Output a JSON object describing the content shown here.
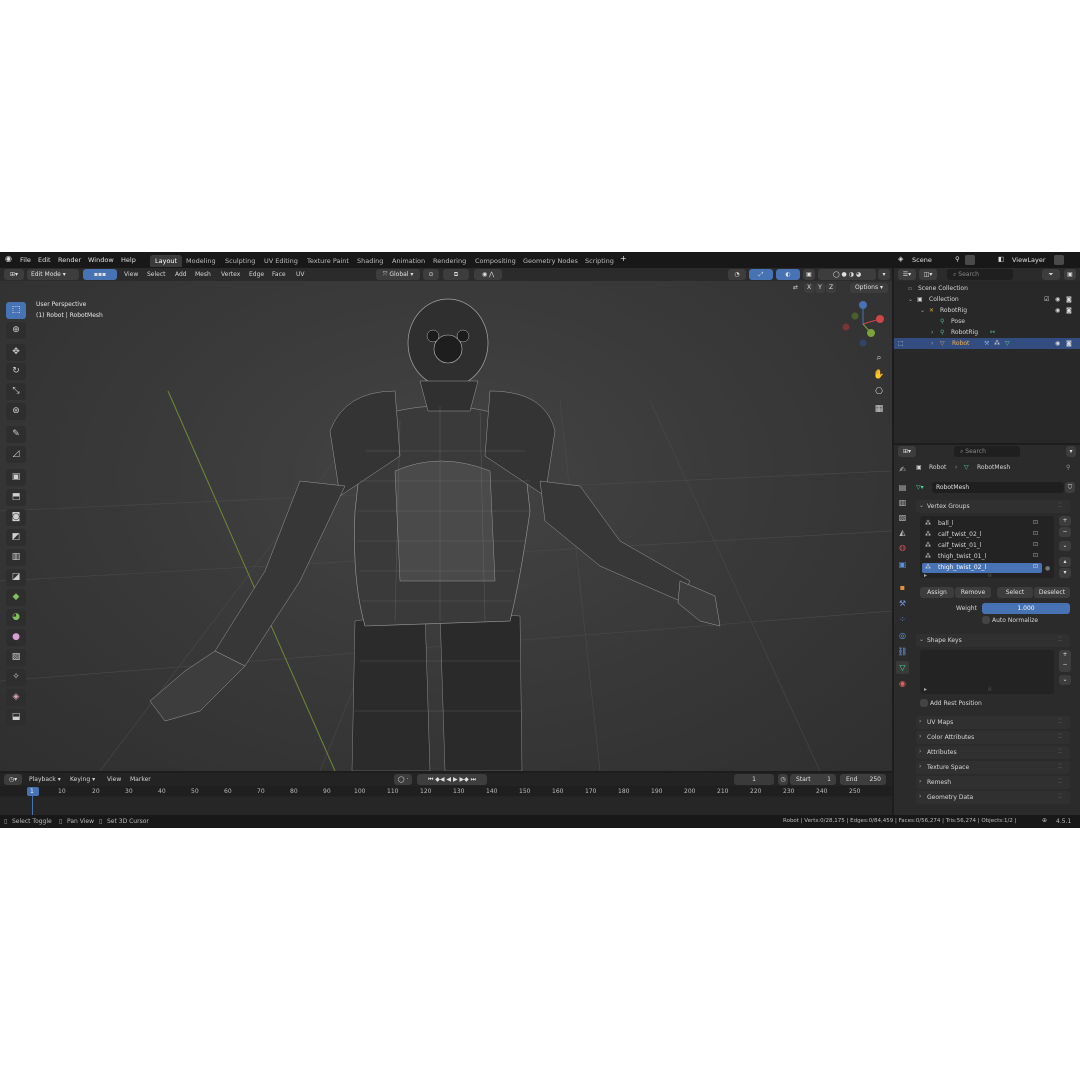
{
  "menu": [
    "File",
    "Edit",
    "Render",
    "Window",
    "Help"
  ],
  "workspaces": [
    "Layout",
    "Modeling",
    "Sculpting",
    "UV Editing",
    "Texture Paint",
    "Shading",
    "Animation",
    "Rendering",
    "Compositing",
    "Geometry Nodes",
    "Scripting"
  ],
  "active_workspace": "Layout",
  "scene": "Scene",
  "view_layer": "ViewLayer",
  "viewport_header": {
    "mode": "Edit Mode",
    "menus": [
      "View",
      "Select",
      "Add",
      "Mesh",
      "Vertex",
      "Edge",
      "Face",
      "UV"
    ],
    "orientation": "Global",
    "options": "Options",
    "axes": [
      "X",
      "Y",
      "Z"
    ]
  },
  "viewport": {
    "perspective": "User Perspective",
    "object_info": "(1) Robot | RobotMesh"
  },
  "outliner": {
    "search_placeholder": "Search",
    "scene_collection": "Scene Collection",
    "collection": "Collection",
    "items": [
      {
        "label": "RobotRig"
      },
      {
        "label": "Pose"
      },
      {
        "label": "RobotRig"
      },
      {
        "label": "Robot"
      }
    ]
  },
  "properties": {
    "search_placeholder": "Search",
    "breadcrumb_object": "Robot",
    "breadcrumb_data": "RobotMesh",
    "mesh_name": "RobotMesh",
    "vertex_groups_title": "Vertex Groups",
    "vertex_groups": [
      "ball_l",
      "calf_twist_02_l",
      "calf_twist_01_l",
      "thigh_twist_01_l",
      "thigh_twist_02_l"
    ],
    "selected_group": "thigh_twist_02_l",
    "buttons": {
      "assign": "Assign",
      "remove": "Remove",
      "select": "Select",
      "deselect": "Deselect"
    },
    "weight_label": "Weight",
    "weight_value": "1.000",
    "auto_normalize": "Auto Normalize",
    "shape_keys_title": "Shape Keys",
    "add_rest_position": "Add Rest Position",
    "collapsed_panels": [
      "UV Maps",
      "Color Attributes",
      "Attributes",
      "Texture Space",
      "Remesh",
      "Geometry Data"
    ]
  },
  "timeline": {
    "menus": [
      "Playback",
      "Keying",
      "View",
      "Marker"
    ],
    "current_frame": "1",
    "start_label": "Start",
    "start": "1",
    "end_label": "End",
    "end": "250",
    "ticks": [
      "1",
      "10",
      "20",
      "30",
      "40",
      "50",
      "60",
      "70",
      "80",
      "90",
      "100",
      "110",
      "120",
      "130",
      "140",
      "150",
      "160",
      "170",
      "180",
      "190",
      "200",
      "210",
      "220",
      "230",
      "240",
      "250"
    ]
  },
  "status": {
    "hints": [
      "Select Toggle",
      "Pan View",
      "Set 3D Cursor"
    ],
    "stats": "Robot | Verts:0/28,175 | Edges:0/84,459 | Faces:0/56,274 | Tris:56,274 | Objects:1/2 |",
    "version": "4.5.1"
  },
  "colors": {
    "accent": "#4772b3",
    "background": "#1d1d1d",
    "viewport": "#3a3a3a"
  }
}
